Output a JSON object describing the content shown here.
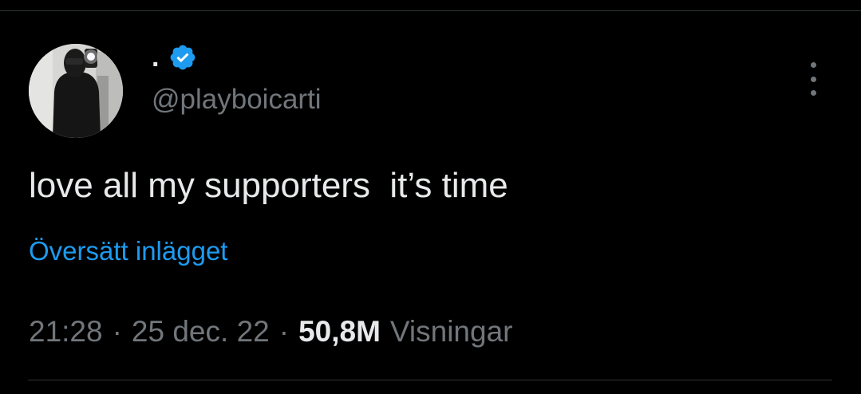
{
  "tweet": {
    "display_name": ".",
    "handle": "@playboicarti",
    "text": "love all my supporters  it’s time",
    "translate_label": "Översätt inlägget",
    "time": "21:28",
    "date": "25 dec. 22",
    "separator": "·",
    "views_count": "50,8M",
    "views_label": "Visningar"
  },
  "icons": {
    "verified": "verified-badge-icon",
    "more": "more-options-icon"
  },
  "colors": {
    "background": "#000000",
    "primary_text": "#e7e9ea",
    "secondary_text": "#71767b",
    "link": "#1d9bf0",
    "verified": "#1d9bf0"
  }
}
